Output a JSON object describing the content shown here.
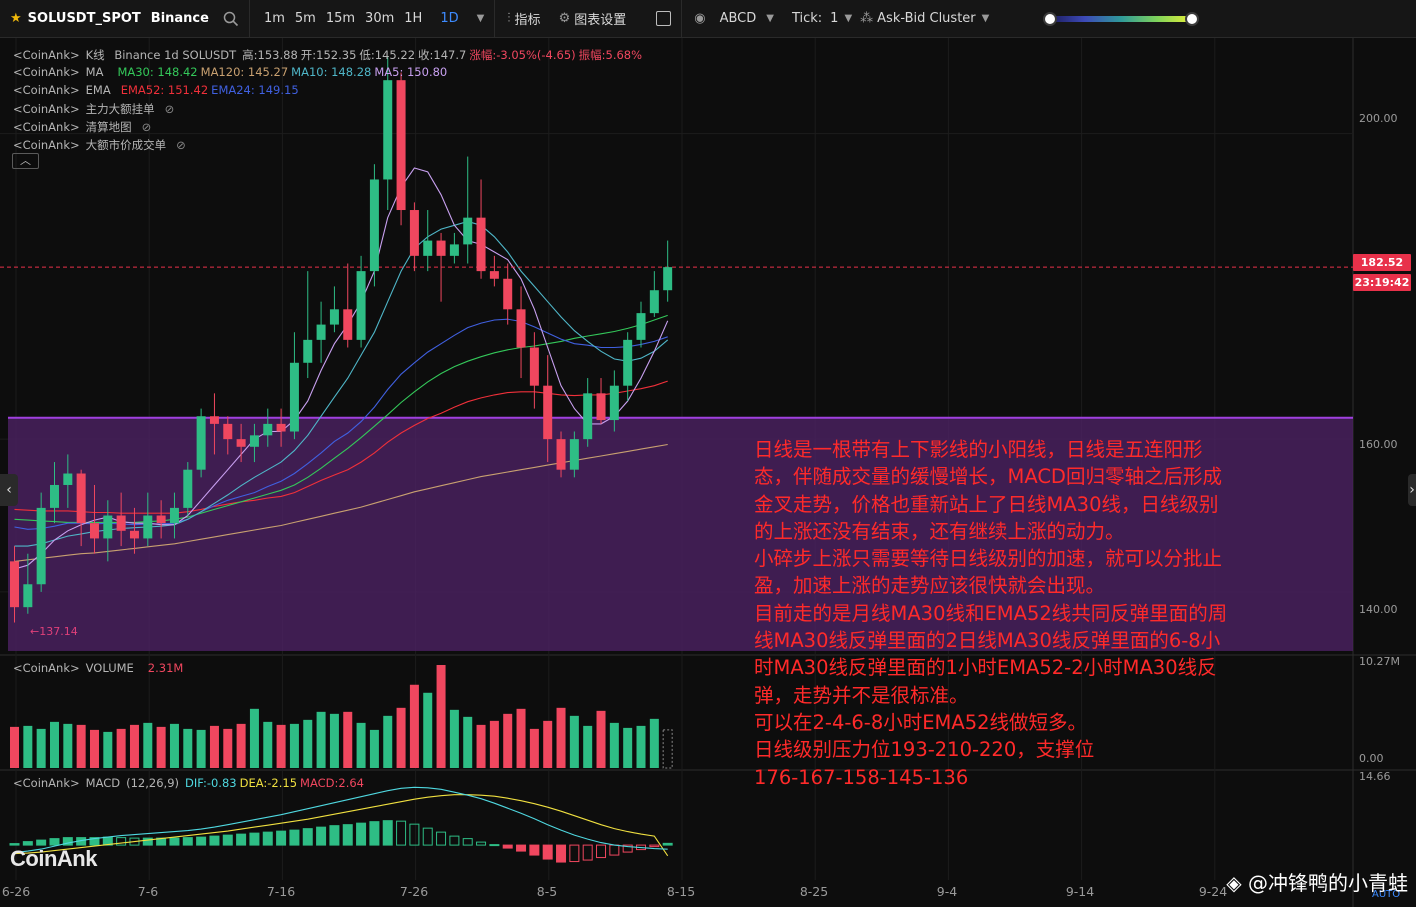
{
  "toolbar": {
    "symbol": "SOLUSDT_SPOT",
    "exchange": "Binance",
    "timeframes": [
      "1m",
      "5m",
      "15m",
      "30m",
      "1H",
      "1D"
    ],
    "active_timeframe": "1D",
    "indicators_label": "指标",
    "chart_settings_label": "图表设置",
    "abcd_label": "ABCD",
    "tick_label": "Tick:",
    "tick_value": "1",
    "cluster_label": "Ask-Bid Cluster",
    "heat_slider_levels": [
      0.0,
      1.0
    ]
  },
  "legends": {
    "kline": {
      "prefix": "<CoinAnk>",
      "name": "K线",
      "info": "Binance 1d SOLUSDT",
      "high": "高:153.88",
      "open": "开:152.35",
      "low": "低:145.22",
      "close": "收:147.7",
      "change": "涨幅:-3.05%(-4.65)",
      "amplitude": "振幅:5.68%"
    },
    "ma": {
      "prefix": "<CoinAnk>",
      "name": "MA",
      "ma30": "MA30: 148.42",
      "ma120": "MA120: 145.27",
      "ma10": "MA10: 148.28",
      "ma5": "MA5: 150.80"
    },
    "ema": {
      "prefix": "<CoinAnk>",
      "name": "EMA",
      "ema52": "EMA52: 151.42",
      "ema24": "EMA24: 149.15"
    },
    "hidden1": {
      "prefix": "<CoinAnk>",
      "name": "主力大额挂单"
    },
    "hidden2": {
      "prefix": "<CoinAnk>",
      "name": "清算地图"
    },
    "hidden3": {
      "prefix": "<CoinAnk>",
      "name": "大额市价成交单"
    },
    "volume": {
      "prefix": "<CoinAnk>",
      "name": "VOLUME",
      "value": "2.31M"
    },
    "macd": {
      "prefix": "<CoinAnk>",
      "name": "MACD",
      "params": "(12,26,9)",
      "dif": "DIF:-0.83",
      "dea": "DEA:-2.15",
      "macd": "MACD:2.64"
    }
  },
  "price_axis": {
    "labels": [
      "200.00",
      "160.00",
      "140.00"
    ],
    "current_price": "182.52",
    "countdown": "23:19:42"
  },
  "volume_axis": {
    "labels": [
      "10.27M",
      "0.00"
    ]
  },
  "macd_axis": {
    "labels": [
      "14.66"
    ]
  },
  "low_marker": "←137.14",
  "date_axis": [
    "6-26",
    "7-6",
    "7-16",
    "7-26",
    "8-5",
    "8-15",
    "8-25",
    "9-4",
    "9-14",
    "9-24"
  ],
  "annotation": [
    "日线是一根带有上下影线的小阳线，日线是五连阳形",
    "态，伴随成交量的缓慢增长，MACD回归零轴之后形成",
    "金叉走势，价格也重新站上了日线MA30线，日线级别",
    "的上涨还没有结束，还有继续上涨的动力。",
    "小碎步上涨只需要等待日线级别的加速，就可以分批止",
    "盈，加速上涨的走势应该很快就会出现。",
    "目前走的是月线MA30线和EMA52线共同反弹里面的周",
    "线MA30线反弹里面的2日线MA30线反弹里面的6-8小",
    "时MA30线反弹里面的1小时EMA52-2小时MA30线反",
    "弹，走势并不是很标准。",
    "可以在2-4-6-8小时EMA52线做短多。",
    "日线级别压力位193-210-220，支撑位",
    "176-167-158-145-136"
  ],
  "logo": "CoinAnk",
  "watermark": "@冲锋鸭的小青蛙",
  "auto_label": "AUTO",
  "colors": {
    "up": "#2ebd85",
    "down": "#f0475f",
    "zone": "#4a2160",
    "zone_line": "#a040e0",
    "annotation": "#ff2a2a"
  },
  "chart_data": {
    "type": "candlestick",
    "symbol": "SOLUSDT",
    "interval": "1d",
    "ylim": [
      132,
      212
    ],
    "candles": [
      {
        "o": 144,
        "h": 146,
        "l": 136,
        "c": 138
      },
      {
        "o": 138,
        "h": 145,
        "l": 137.14,
        "c": 141
      },
      {
        "o": 141,
        "h": 153,
        "l": 140,
        "c": 151
      },
      {
        "o": 151,
        "h": 157,
        "l": 149,
        "c": 154
      },
      {
        "o": 154,
        "h": 158,
        "l": 151,
        "c": 155.5
      },
      {
        "o": 155.5,
        "h": 156,
        "l": 146,
        "c": 149
      },
      {
        "o": 149,
        "h": 154,
        "l": 145,
        "c": 147
      },
      {
        "o": 147,
        "h": 152,
        "l": 144,
        "c": 150
      },
      {
        "o": 150,
        "h": 153,
        "l": 146,
        "c": 148
      },
      {
        "o": 148,
        "h": 151,
        "l": 145,
        "c": 147
      },
      {
        "o": 147,
        "h": 153,
        "l": 146,
        "c": 150
      },
      {
        "o": 150,
        "h": 152,
        "l": 147,
        "c": 149
      },
      {
        "o": 149,
        "h": 153,
        "l": 147,
        "c": 151
      },
      {
        "o": 151,
        "h": 157,
        "l": 150,
        "c": 156
      },
      {
        "o": 156,
        "h": 164,
        "l": 155,
        "c": 163
      },
      {
        "o": 163,
        "h": 166,
        "l": 158,
        "c": 162
      },
      {
        "o": 162,
        "h": 163,
        "l": 158,
        "c": 160
      },
      {
        "o": 160,
        "h": 162,
        "l": 157,
        "c": 159
      },
      {
        "o": 159,
        "h": 162,
        "l": 157,
        "c": 160.5
      },
      {
        "o": 160.5,
        "h": 164,
        "l": 159,
        "c": 162
      },
      {
        "o": 162,
        "h": 164,
        "l": 159,
        "c": 161
      },
      {
        "o": 161,
        "h": 174,
        "l": 160,
        "c": 170
      },
      {
        "o": 170,
        "h": 182,
        "l": 168,
        "c": 173
      },
      {
        "o": 173,
        "h": 178,
        "l": 170,
        "c": 175
      },
      {
        "o": 175,
        "h": 180,
        "l": 174,
        "c": 177
      },
      {
        "o": 177,
        "h": 183,
        "l": 172,
        "c": 173
      },
      {
        "o": 173,
        "h": 184,
        "l": 172,
        "c": 182
      },
      {
        "o": 182,
        "h": 196,
        "l": 180,
        "c": 194
      },
      {
        "o": 194,
        "h": 210,
        "l": 190,
        "c": 207
      },
      {
        "o": 207,
        "h": 208,
        "l": 188,
        "c": 190
      },
      {
        "o": 190,
        "h": 191,
        "l": 182,
        "c": 184
      },
      {
        "o": 184,
        "h": 190,
        "l": 182,
        "c": 186
      },
      {
        "o": 186,
        "h": 187,
        "l": 178,
        "c": 184
      },
      {
        "o": 184,
        "h": 187,
        "l": 183,
        "c": 185.5
      },
      {
        "o": 185.5,
        "h": 197,
        "l": 183,
        "c": 189
      },
      {
        "o": 189,
        "h": 194,
        "l": 181,
        "c": 182
      },
      {
        "o": 182,
        "h": 184,
        "l": 180,
        "c": 181
      },
      {
        "o": 181,
        "h": 183,
        "l": 175,
        "c": 177
      },
      {
        "o": 177,
        "h": 180,
        "l": 168,
        "c": 172
      },
      {
        "o": 172,
        "h": 174,
        "l": 164,
        "c": 167
      },
      {
        "o": 167,
        "h": 171,
        "l": 157,
        "c": 160
      },
      {
        "o": 160,
        "h": 161,
        "l": 155,
        "c": 156
      },
      {
        "o": 156,
        "h": 161,
        "l": 155,
        "c": 160
      },
      {
        "o": 160,
        "h": 168,
        "l": 159,
        "c": 166
      },
      {
        "o": 166,
        "h": 168,
        "l": 162,
        "c": 162.5
      },
      {
        "o": 162.5,
        "h": 169,
        "l": 161,
        "c": 167
      },
      {
        "o": 167,
        "h": 174,
        "l": 165,
        "c": 173
      },
      {
        "o": 173,
        "h": 178,
        "l": 172,
        "c": 176.5
      },
      {
        "o": 176.5,
        "h": 182,
        "l": 176,
        "c": 179.5
      },
      {
        "o": 179.5,
        "h": 186,
        "l": 178,
        "c": 182.52
      }
    ],
    "ma5": [
      143,
      143.5,
      145,
      146.8,
      148,
      148.8,
      149.4,
      149.8,
      149.2,
      149,
      149,
      148.8,
      148.8,
      150,
      152,
      154,
      156,
      158,
      160,
      161,
      161,
      162.5,
      165,
      169,
      172.5,
      175,
      178,
      182,
      189,
      193,
      195.5,
      195,
      192,
      188,
      186,
      185.5,
      184.5,
      183.5,
      181,
      177,
      172,
      167,
      164,
      162,
      162,
      163,
      165,
      168,
      171.5,
      175.5
    ],
    "ma10": [
      146,
      146,
      146.3,
      146.8,
      147.3,
      147.6,
      147.9,
      148.1,
      148.3,
      148.4,
      148.5,
      148.6,
      148.8,
      149.5,
      150.5,
      151.6,
      152.7,
      153.9,
      155,
      156,
      157,
      158.5,
      160.5,
      163,
      165.5,
      168,
      171,
      174,
      178,
      182,
      185,
      186.5,
      187.5,
      188,
      188.5,
      188,
      186.5,
      184.5,
      182,
      180,
      178,
      176,
      174.2,
      172.8,
      171.5,
      170.5,
      170.2,
      170.6,
      171.5,
      173
    ],
    "ema24": [
      148.5,
      148.2,
      148.3,
      148.6,
      149,
      149,
      148.9,
      149,
      148.9,
      148.8,
      148.9,
      148.9,
      149,
      149.5,
      150.5,
      151.3,
      152,
      152.5,
      153,
      153.8,
      154.5,
      155.5,
      156.8,
      158.2,
      159.7,
      160.8,
      162.3,
      164.2,
      166.5,
      168.5,
      170,
      171.4,
      172.5,
      173.6,
      174.6,
      175.2,
      175.6,
      175.7,
      175.4,
      174.7,
      173.9,
      173.1,
      172.5,
      172.3,
      172,
      172,
      172.1,
      172.4,
      172.8,
      173.4
    ],
    "ma30": [
      149.5,
      149.4,
      149.3,
      149.2,
      149.1,
      149.1,
      149.1,
      149.1,
      149.1,
      149.1,
      149.2,
      149.3,
      149.5,
      149.8,
      150.3,
      150.8,
      151.3,
      151.8,
      152.3,
      152.8,
      153.3,
      154,
      155,
      156.2,
      157.5,
      158.8,
      160.2,
      161.7,
      163.2,
      164.8,
      166.2,
      167.5,
      168.6,
      169.5,
      170.2,
      170.8,
      171.3,
      171.7,
      172,
      172.2,
      172.5,
      172.8,
      173.2,
      173.5,
      173.8,
      174.1,
      174.5,
      175,
      175.6,
      176.2
    ],
    "ema52": [
      150.8,
      150.7,
      150.6,
      150.6,
      150.6,
      150.5,
      150.4,
      150.4,
      150.3,
      150.3,
      150.3,
      150.3,
      150.3,
      150.5,
      150.8,
      151.2,
      151.5,
      151.8,
      152,
      152.3,
      152.5,
      153,
      153.8,
      154.6,
      155.3,
      156,
      157,
      158.2,
      159.6,
      160.8,
      161.8,
      162.7,
      163.4,
      164.2,
      164.9,
      165.4,
      165.8,
      166.1,
      166.2,
      166.2,
      166,
      165.8,
      165.7,
      165.8,
      165.8,
      166,
      166.3,
      166.6,
      167,
      167.6
    ],
    "ma120": [
      144,
      144.2,
      144.4,
      144.6,
      144.8,
      145,
      145.1,
      145.3,
      145.5,
      145.7,
      145.9,
      146.1,
      146.3,
      146.6,
      146.9,
      147.2,
      147.5,
      147.8,
      148.1,
      148.4,
      148.7,
      149.1,
      149.5,
      149.9,
      150.3,
      150.7,
      151.1,
      151.6,
      152.1,
      152.6,
      153.1,
      153.5,
      153.9,
      154.3,
      154.7,
      155.1,
      155.4,
      155.7,
      156,
      156.3,
      156.6,
      156.9,
      157.2,
      157.5,
      157.8,
      158.1,
      158.4,
      158.7,
      159,
      159.3
    ],
    "zone": {
      "top": 162.8,
      "bottom": 137.5
    },
    "current_price": 182.52,
    "volume": [
      4.1,
      4.2,
      3.9,
      4.6,
      4.4,
      4.3,
      3.8,
      3.6,
      3.9,
      4.3,
      4.5,
      4.1,
      4.4,
      3.9,
      3.8,
      4.2,
      3.9,
      4.4,
      5.9,
      4.6,
      4.3,
      4.4,
      4.8,
      5.6,
      5.4,
      5.6,
      4.5,
      3.8,
      5.2,
      6.0,
      8.3,
      7.5,
      10.27,
      5.8,
      5.1,
      4.3,
      4.7,
      5.4,
      5.9,
      3.9,
      4.7,
      6.0,
      5.2,
      4.2,
      5.7,
      4.5,
      4.0,
      4.2,
      4.9,
      3.8
    ],
    "volume_ylim": [
      0,
      10.27
    ],
    "macd_hist": [
      0.3,
      0.7,
      1.0,
      1.3,
      1.5,
      1.5,
      1.5,
      1.6,
      1.5,
      1.4,
      1.4,
      1.4,
      1.4,
      1.5,
      1.6,
      1.8,
      2.0,
      2.2,
      2.4,
      2.6,
      2.8,
      3.0,
      3.3,
      3.6,
      3.9,
      4.1,
      4.4,
      4.7,
      4.9,
      4.8,
      4.2,
      3.4,
      2.6,
      1.8,
      1.3,
      0.6,
      0.1,
      -0.6,
      -1.2,
      -2.0,
      -2.8,
      -3.4,
      -3.3,
      -3.0,
      -2.5,
      -2.0,
      -1.4,
      -0.9,
      -0.3,
      0.35
    ],
    "macd_dif": [
      -1.5,
      -1.2,
      -0.8,
      -0.2,
      0.4,
      0.9,
      1.3,
      1.6,
      1.9,
      2.1,
      2.3,
      2.5,
      2.7,
      2.9,
      3.2,
      3.6,
      4.1,
      4.6,
      5.1,
      5.6,
      6.1,
      6.7,
      7.3,
      7.9,
      8.5,
      9.1,
      9.7,
      10.3,
      10.9,
      11.4,
      11.6,
      11.5,
      11.2,
      10.6,
      10.0,
      9.3,
      8.4,
      7.4,
      6.4,
      5.3,
      4.1,
      3.0,
      2.0,
      1.2,
      0.5,
      0.0,
      -0.3,
      -0.5,
      -0.7,
      -0.83
    ],
    "macd_dea": [
      -1.7,
      -1.6,
      -1.4,
      -1.1,
      -0.8,
      -0.5,
      -0.2,
      0.1,
      0.4,
      0.7,
      1.0,
      1.3,
      1.6,
      1.9,
      2.2,
      2.5,
      2.8,
      3.2,
      3.6,
      4.0,
      4.4,
      4.8,
      5.2,
      5.7,
      6.2,
      6.7,
      7.2,
      7.7,
      8.2,
      8.7,
      9.2,
      9.6,
      9.9,
      10.1,
      10.1,
      10.0,
      9.8,
      9.4,
      8.9,
      8.3,
      7.6,
      6.8,
      5.9,
      5.0,
      4.1,
      3.3,
      2.7,
      2.2,
      1.8,
      -2.15
    ],
    "macd_ylim": [
      -7,
      14.66
    ]
  }
}
